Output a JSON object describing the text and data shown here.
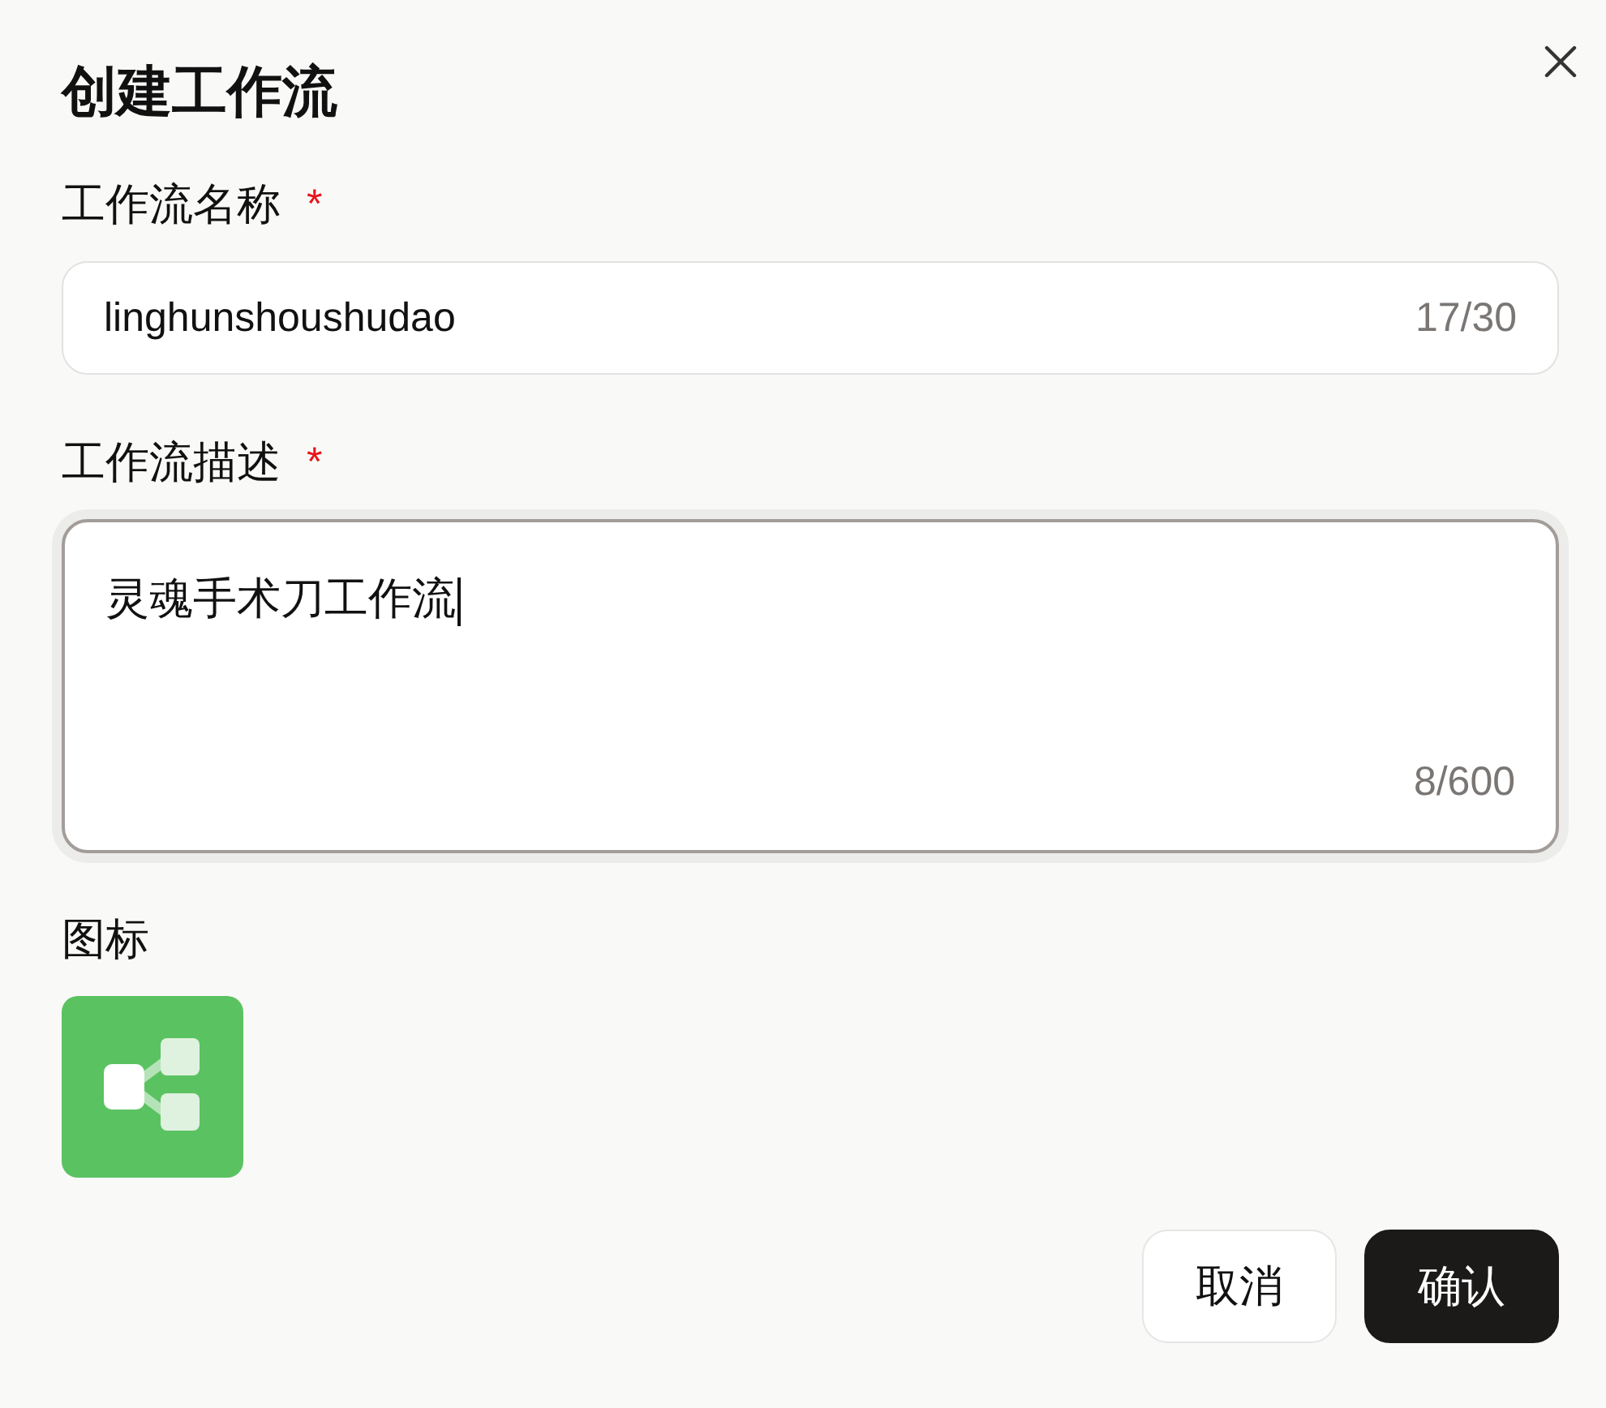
{
  "dialog": {
    "title": "创建工作流"
  },
  "fields": [
    {
      "kind": "input",
      "label": "工作流名称",
      "required_mark": "*",
      "value": "linghunshoushudao",
      "counter": "17/30",
      "focused": false
    },
    {
      "kind": "textarea",
      "label": "工作流描述",
      "required_mark": "*",
      "value": "灵魂手术刀工作流",
      "counter": "8/600",
      "focused": true
    }
  ],
  "icon_picker": {
    "label": "图标"
  },
  "buttons": [
    {
      "label": "取消",
      "kind": "secondary"
    },
    {
      "label": "确认",
      "kind": "primary"
    }
  ]
}
